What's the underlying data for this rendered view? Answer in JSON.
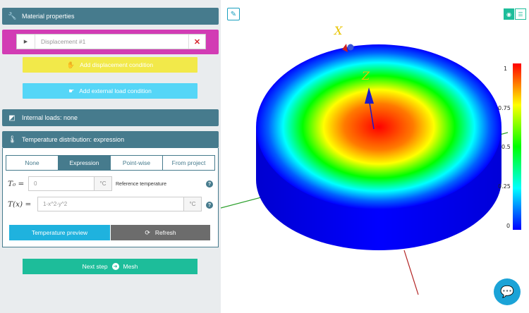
{
  "sidebar": {
    "material_properties": "Material properties",
    "displacement_placeholder": "Displacement #1",
    "add_displacement": "Add displacement condition",
    "add_external_load": "Add external load condition",
    "internal_loads": "Internal loads: none",
    "temperature_header": "Temperature distribution: expression",
    "tabs": [
      {
        "label": "None",
        "active": false
      },
      {
        "label": "Expression",
        "active": true
      },
      {
        "label": "Point-wise",
        "active": false
      },
      {
        "label": "From project",
        "active": false
      }
    ],
    "t0_label": "T₀ =",
    "t0_value": "0",
    "t0_unit": "°C",
    "t0_description": "Reference temperature",
    "tx_label": "T(x) =",
    "tx_value": "1-x^2-y^2",
    "tx_unit": "°C",
    "preview_button": "Temperature preview",
    "refresh_button": "Refresh",
    "next_step": "Next step",
    "next_target": "Mesh"
  },
  "viewer": {
    "axis_x_label": "X",
    "axis_z_label": "Z",
    "colorbar_ticks": [
      "1",
      "0.75",
      "0.5",
      "0.25",
      "0"
    ],
    "colormap": [
      "#0000ff",
      "#00ffff",
      "#00ff00",
      "#ffff00",
      "#ff0000"
    ]
  },
  "colors": {
    "header": "#467b8d",
    "magenta": "#d23cb4",
    "yellow": "#f2e94a",
    "cyan": "#55d6f7",
    "teal": "#1dbd9a",
    "preview": "#1fb2de",
    "refresh": "#6c6c6c"
  }
}
